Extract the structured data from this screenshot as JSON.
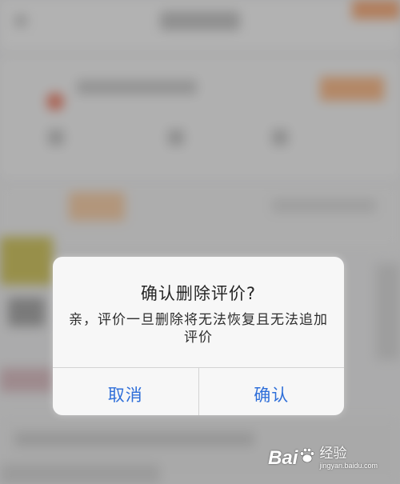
{
  "dialog": {
    "title": "确认删除评价?",
    "message": "亲，评价一旦删除将无法恢复且无法追加评价",
    "cancel_label": "取消",
    "confirm_label": "确认"
  },
  "watermark": {
    "logo_prefix": "Bai",
    "logo_suffix": "",
    "name": "经验",
    "url": "jingyan.baidu.com"
  },
  "colors": {
    "button_text": "#2f6fd9",
    "dialog_bg": "#f7f7f7",
    "overlay": "rgba(70,70,70,0.38)",
    "accent_orange": "#f5a25a"
  },
  "icons": [
    "baidu-paw-icon"
  ]
}
